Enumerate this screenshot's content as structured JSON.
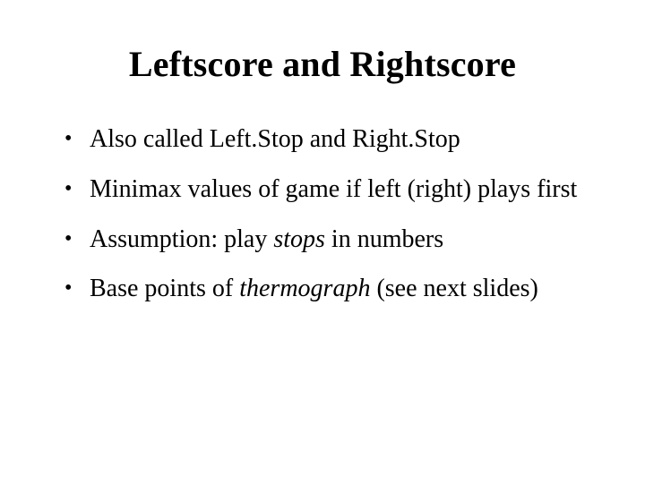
{
  "title": "Leftscore and Rightscore",
  "bullets": {
    "b0": "Also called Left.Stop and Right.Stop",
    "b1": "Minimax values of game if left (right) plays first",
    "b2_pre": "Assumption: play ",
    "b2_em": "stops",
    "b2_post": " in numbers",
    "b3_pre": "Base points of ",
    "b3_em": "thermograph",
    "b3_post": " (see next slides)"
  }
}
